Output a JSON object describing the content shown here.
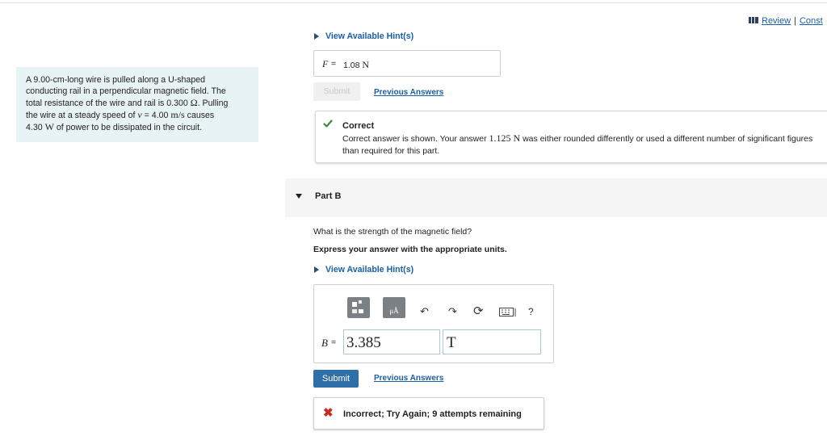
{
  "header": {
    "review_label": "Review",
    "separator": "|",
    "constants_label": "Const"
  },
  "problem": {
    "line1": "A 9.00-cm-long wire is pulled along a U-shaped",
    "line2": "conducting rail in a perpendicular magnetic field. The",
    "line3_text": "total resistance of the wire and rail is 0.300 ",
    "line3_unit": "Ω",
    "line3_end": ". Pulling",
    "line4_text": "the wire at a steady speed of ",
    "line4_var": "v",
    "line4_eq": " = 4.00 ",
    "line4_unit": "m/s",
    "line4_end": " causes",
    "line5_num": "4.30 ",
    "line5_unit": "W",
    "line5_end": " of power to be dissipated in the circuit."
  },
  "part_a": {
    "hint_label": "View Available Hint(s)",
    "answer_var": "F",
    "answer_eq": "=",
    "answer_value": "1.08 ",
    "answer_unit": "N",
    "submit_label": "Submit",
    "previous_answers_label": "Previous Answers",
    "feedback_title": "Correct",
    "feedback_text_1": "Correct answer is shown. Your answer ",
    "feedback_math": "1.125 N",
    "feedback_text_2": " was either rounded differently or used a different number of significant figures than required for this part."
  },
  "part_b": {
    "title": "Part B",
    "question": "What is the strength of the magnetic field?",
    "instruction": "Express your answer with the appropriate units.",
    "hint_label": "View Available Hint(s)",
    "toolbar": {
      "undo": "↶",
      "redo": "↷",
      "reset": "⟳",
      "help": "?"
    },
    "answer_var": "B",
    "answer_eq": "=",
    "answer_value": "3.385",
    "answer_unit": "T",
    "submit_label": "Submit",
    "previous_answers_label": "Previous Answers",
    "feedback_text": "Incorrect; Try Again; 9 attempts remaining"
  },
  "colors": {
    "link": "#1a5fa8",
    "submit_active": "#2f6ea6",
    "correct_check": "#3b8a3e",
    "incorrect_x": "#cc2b22",
    "problem_bg": "#e8f3f6"
  }
}
